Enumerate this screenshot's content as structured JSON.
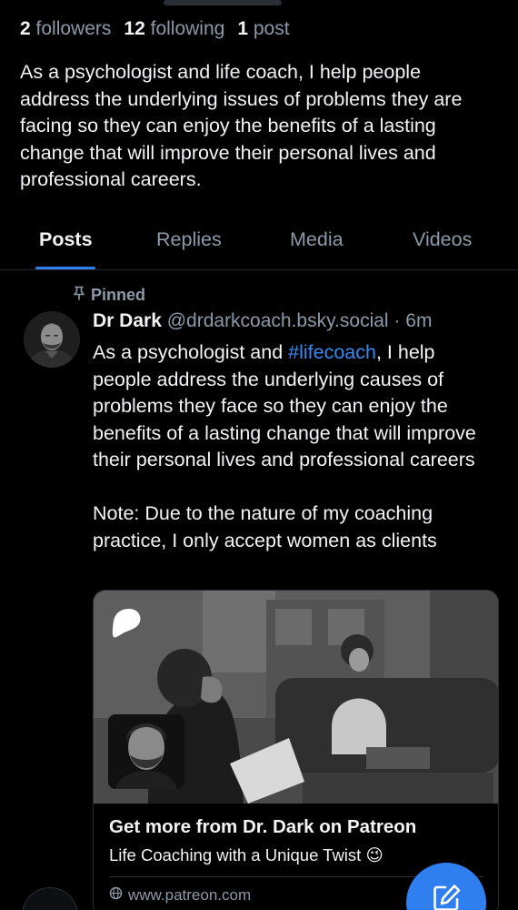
{
  "stats": [
    {
      "count": "2",
      "label": "followers"
    },
    {
      "count": "12",
      "label": "following"
    },
    {
      "count": "1",
      "label": "post"
    }
  ],
  "bio": "As a psychologist and life coach, I help people address the underlying issues of problems they are facing so they can enjoy the benefits of a lasting change that will improve their personal lives and professional careers.",
  "tabs": [
    "Posts",
    "Replies",
    "Media",
    "Videos"
  ],
  "active_tab": "Posts",
  "pinned_label": "Pinned",
  "post": {
    "author": "Dr Dark",
    "handle": "@drdarkcoach.bsky.social",
    "separator": "·",
    "time": "6m",
    "text_before": "As a psychologist and ",
    "hashtag": "#lifecoach",
    "text_after": ", I help people address the underlying causes of problems they face so they can enjoy the benefits of a lasting change that will improve their personal lives and professional careers",
    "note": "Note: Due to the nature of my coaching practice, I only accept women as clients"
  },
  "link_card": {
    "title": "Get more from Dr. Dark on Patreon",
    "description": "Life Coaching with a Unique Twist 😉",
    "domain": "www.patreon.com"
  },
  "icons": {
    "pin": "pin-icon",
    "globe": "globe-icon",
    "compose": "compose-icon",
    "patreon": "patreon-logo"
  },
  "colors": {
    "background": "#000000",
    "text": "#f1f3f5",
    "muted": "#8d99a8",
    "accent": "#2f7ff0",
    "border": "#2a2f36"
  }
}
